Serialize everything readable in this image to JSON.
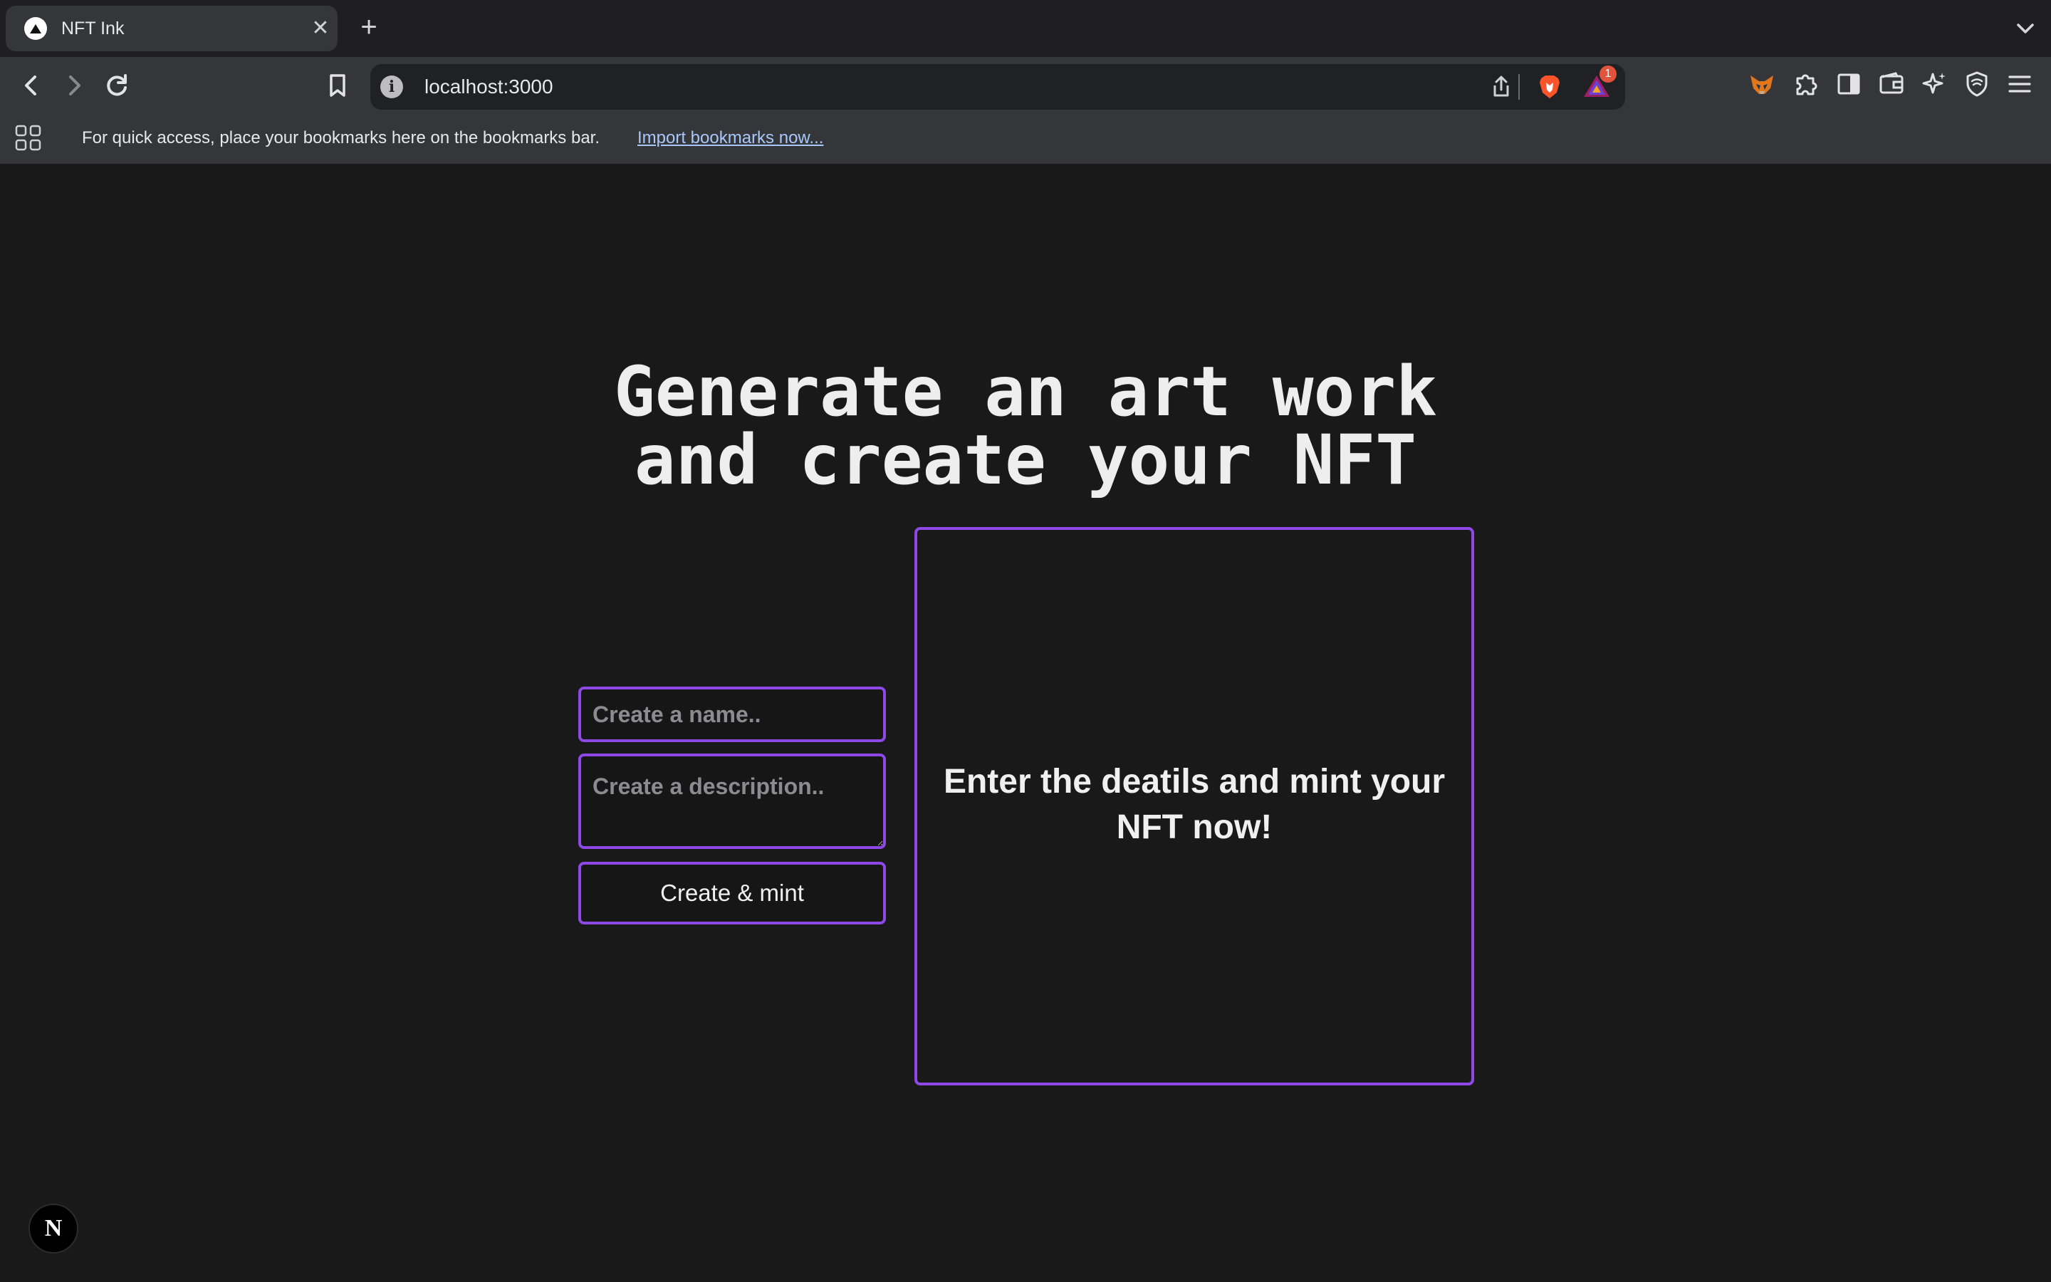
{
  "browser": {
    "tab": {
      "title": "NFT Ink"
    },
    "address_bar": {
      "url": "localhost:3000"
    },
    "rewards_badge": "1",
    "bookmarks_bar": {
      "message": "For quick access, place your bookmarks here on the bookmarks bar.",
      "import_link": "Import bookmarks now..."
    },
    "icons": [
      "back-icon",
      "forward-icon",
      "reload-icon",
      "bookmark-icon",
      "info-icon",
      "share-icon",
      "brave-shields-icon",
      "brave-rewards-icon",
      "metamask-icon",
      "extensions-icon",
      "sidebar-icon",
      "wallet-icon",
      "leo-ai-icon",
      "vpn-icon",
      "menu-icon",
      "apps-icon"
    ]
  },
  "page": {
    "headline_line1": "Generate an art work",
    "headline_line2": "and create your NFT",
    "form": {
      "name_placeholder": "Create a name..",
      "description_placeholder": "Create a description..",
      "submit_label": "Create & mint"
    },
    "preview_message": "Enter the deatils and mint your NFT now!",
    "dev_badge": "N"
  },
  "colors": {
    "accent": "#8d48e5",
    "page_background": "#19191a",
    "browser_chrome": "#35363a"
  }
}
